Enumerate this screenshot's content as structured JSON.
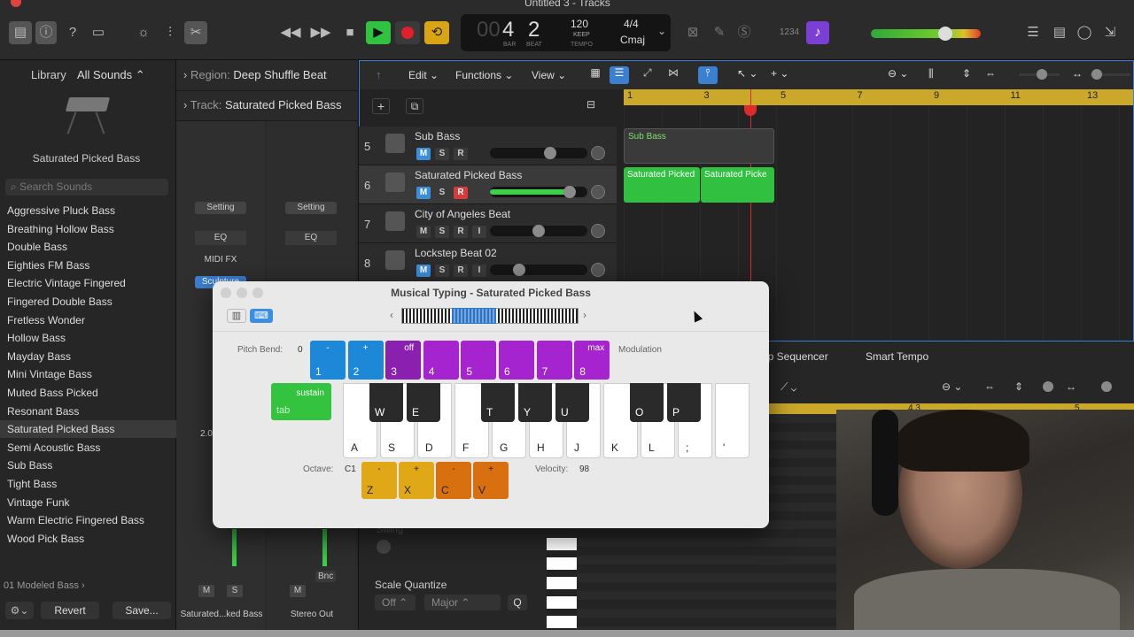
{
  "window": {
    "title": "Untitled 3 - Tracks"
  },
  "lcd": {
    "bar": "4",
    "beat": "2",
    "bar_label": "BAR",
    "beat_label": "BEAT",
    "tempo": "120",
    "tempo_mode": "KEEP",
    "tempo_label": "TEMPO",
    "signature": "4/4",
    "key": "Cmaj"
  },
  "toolbar": {
    "count_in": "1234"
  },
  "library": {
    "title": "Library",
    "filter": "All Sounds",
    "selected_patch": "Saturated Picked Bass",
    "search_placeholder": "Search Sounds",
    "items": [
      "Aggressive Pluck Bass",
      "Breathing Hollow Bass",
      "Double Bass",
      "Eighties FM Bass",
      "Electric Vintage Fingered",
      "Fingered Double Bass",
      "Fretless Wonder",
      "Hollow Bass",
      "Mayday Bass",
      "Mini Vintage Bass",
      "Muted Bass Picked",
      "Resonant Bass",
      "Saturated Picked Bass",
      "Semi Acoustic Bass",
      "Sub Bass",
      "Tight Bass",
      "Vintage Funk",
      "Warm Electric Fingered Bass",
      "Wood Pick Bass"
    ],
    "category": "01 Modeled Bass",
    "revert": "Revert",
    "save": "Save..."
  },
  "inspector": {
    "region_label": "Region:",
    "region_name": "Deep Shuffle Beat",
    "track_label": "Track:",
    "track_name": "Saturated Picked Bass",
    "setting": "Setting",
    "eq": "EQ",
    "midi_fx": "MIDI FX",
    "plugin": "Sculpture",
    "volume": "2.0",
    "bnc": "Bnc",
    "strip1_name": "Saturated...ked Bass",
    "strip2_name": "Stereo Out",
    "m": "M",
    "s": "S"
  },
  "tracks_menu": {
    "edit": "Edit",
    "functions": "Functions",
    "view": "View"
  },
  "ruler": [
    "1",
    "3",
    "5",
    "7",
    "9",
    "11",
    "13"
  ],
  "tracks": [
    {
      "num": "5",
      "name": "Sub Bass"
    },
    {
      "num": "6",
      "name": "Saturated Picked Bass"
    },
    {
      "num": "7",
      "name": "City of Angeles Beat"
    },
    {
      "num": "8",
      "name": "Lockstep Beat 02"
    }
  ],
  "regions": {
    "sub": "Sub Bass",
    "sat1": "Saturated Picked",
    "sat2": "Saturated Picke"
  },
  "lower": {
    "tab1": "ep Sequencer",
    "tab2": "Smart Tempo",
    "ruler1": "4.3",
    "ruler2": "5",
    "swing": "Swing",
    "scale_quantize": "Scale Quantize",
    "sq_off": "Off",
    "sq_major": "Major",
    "q": "Q"
  },
  "musical_typing": {
    "title": "Musical Typing - Saturated Picked Bass",
    "pitch_bend_label": "Pitch Bend:",
    "pitch_bend_value": "0",
    "modulation_label": "Modulation",
    "number_keys": [
      {
        "top": "-",
        "key": "1",
        "color": "#1e88d8"
      },
      {
        "top": "+",
        "key": "2",
        "color": "#1e88d8"
      },
      {
        "top": "off",
        "key": "3",
        "color": "#8a1fb0"
      },
      {
        "top": "",
        "key": "4",
        "color": "#a524d0"
      },
      {
        "top": "",
        "key": "5",
        "color": "#a524d0"
      },
      {
        "top": "",
        "key": "6",
        "color": "#a524d0"
      },
      {
        "top": "",
        "key": "7",
        "color": "#a524d0"
      },
      {
        "top": "max",
        "key": "8",
        "color": "#a524d0"
      }
    ],
    "sustain_label": "sustain",
    "sustain_key": "tab",
    "white_keys": [
      "A",
      "S",
      "D",
      "F",
      "G",
      "H",
      "J",
      "K",
      "L",
      ";",
      "'"
    ],
    "black_keys": [
      "W",
      "E",
      "T",
      "Y",
      "U",
      "O",
      "P"
    ],
    "octave_label": "Octave:",
    "octave_value": "C1",
    "octave_keys": [
      {
        "top": "-",
        "key": "Z",
        "color": "#e0a817"
      },
      {
        "top": "+",
        "key": "X",
        "color": "#e0a817"
      },
      {
        "top": "-",
        "key": "C",
        "color": "#d9700f"
      },
      {
        "top": "+",
        "key": "V",
        "color": "#d9700f"
      }
    ],
    "velocity_label": "Velocity:",
    "velocity_value": "98"
  }
}
